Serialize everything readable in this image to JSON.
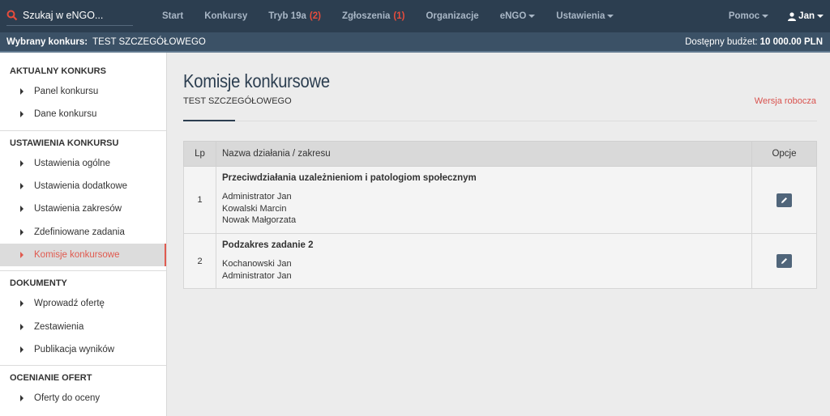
{
  "topbar": {
    "search_placeholder": "Szukaj w eNGO...",
    "nav": [
      {
        "label": "Start",
        "count": ""
      },
      {
        "label": "Konkursy",
        "count": ""
      },
      {
        "label": "Tryb 19a",
        "count": "(2)"
      },
      {
        "label": "Zgłoszenia",
        "count": "(1)"
      },
      {
        "label": "Organizacje",
        "count": ""
      },
      {
        "label": "eNGO",
        "count": ""
      },
      {
        "label": "Ustawienia",
        "count": ""
      }
    ],
    "help_label": "Pomoc",
    "user_label": "Jan"
  },
  "subbar": {
    "selected_label": "Wybrany konkurs:",
    "selected_value": "TEST SZCZEGÓŁOWEGO",
    "budget_label": "Dostępny budżet:",
    "budget_value": "10 000.00 PLN"
  },
  "sidebar": {
    "sections": [
      {
        "title": "AKTUALNY KONKURS",
        "items": [
          "Panel konkursu",
          "Dane konkursu"
        ]
      },
      {
        "title": "USTAWIENIA KONKURSU",
        "items": [
          "Ustawienia ogólne",
          "Ustawienia dodatkowe",
          "Ustawienia zakresów",
          "Zdefiniowane zadania",
          "Komisje konkursowe"
        ]
      },
      {
        "title": "DOKUMENTY",
        "items": [
          "Wprowadź ofertę",
          "Zestawienia",
          "Publikacja wyników"
        ]
      },
      {
        "title": "OCENIANIE OFERT",
        "items": [
          "Oferty do oceny"
        ]
      }
    ]
  },
  "main": {
    "title": "Komisje konkursowe",
    "subtitle": "TEST SZCZEGÓŁOWEGO",
    "status": "Wersja robocza",
    "table": {
      "headers": [
        "Lp",
        "Nazwa działania / zakresu",
        "Opcje"
      ],
      "rows": [
        {
          "lp": "1",
          "name": "Przeciwdziałania uzależnieniom i patologiom społecznym",
          "members": [
            "Administrator Jan",
            "Kowalski Marcin",
            "Nowak Małgorzata"
          ]
        },
        {
          "lp": "2",
          "name": "Podzakres zadanie 2",
          "members": [
            "Kochanowski Jan",
            "Administrator Jan"
          ]
        }
      ]
    }
  },
  "colors": {
    "navbar": "#2c3e50",
    "accent_red": "#e05a4f",
    "edit_button": "#50657a"
  },
  "icons": {
    "search": "search-icon",
    "caret": "caret-down-icon",
    "user": "user-icon",
    "edit": "pencil-icon",
    "bullet": "triangle-right-icon"
  }
}
